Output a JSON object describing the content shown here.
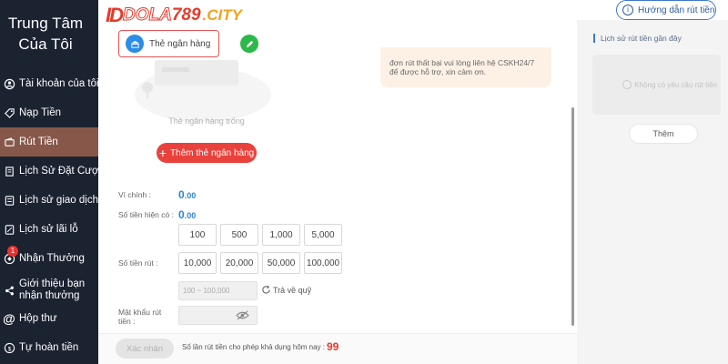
{
  "sidebar": {
    "title_line1": "Trung Tâm",
    "title_line2": "Của Tôi",
    "items": [
      {
        "label": "Tài khoản của tôi",
        "icon": "user-icon"
      },
      {
        "label": "Nạp Tiền",
        "icon": "tag-icon"
      },
      {
        "label": "Rút Tiền",
        "icon": "wallet-icon",
        "active": true
      },
      {
        "label": "Lịch Sử Đặt Cược",
        "icon": "document-icon"
      },
      {
        "label": "Lịch sử giao dịch",
        "icon": "list-icon"
      },
      {
        "label": "Lịch sử lãi lỗ",
        "icon": "chart-icon"
      },
      {
        "label": "Nhận Thưởng",
        "icon": "gift-icon",
        "badge": "1"
      },
      {
        "label": "Giới thiệu bạn nhận thưởng",
        "icon": "share-icon"
      },
      {
        "label": "Hộp thư",
        "icon": "at-icon"
      },
      {
        "label": "Tự hoàn tiền",
        "icon": "refund-icon"
      }
    ]
  },
  "logo": {
    "mark": "ID",
    "word_prefix": "DOLA",
    "word_digits": "789",
    "suffix": ".CITY"
  },
  "guide_button": {
    "label": "Hướng dẫn rút tiền",
    "icon": "question-icon"
  },
  "bank_tab": {
    "label": "Thẻ ngân hàng",
    "icon": "bank-icon"
  },
  "empty_bank": {
    "text": "Thẻ ngân hàng trống"
  },
  "add_bank_button": {
    "label": "Thêm thẻ ngân hàng"
  },
  "notice": {
    "text": "đơn rút thất bại vui lòng liên hệ CSKH24/7 để được hỗ trợ, xin cảm ơn."
  },
  "form": {
    "main_wallet_label": "Ví chính :",
    "main_wallet_value": "0",
    "main_wallet_decimals": ".00",
    "current_label": "Số tiền hiện có :",
    "current_value": "0",
    "current_decimals": ".00",
    "withdraw_label": "Số tiền rút :",
    "amounts_row1": [
      "100",
      "500",
      "1,000",
      "5,000"
    ],
    "amounts_row2": [
      "10,000",
      "20,000",
      "50,000",
      "100,000"
    ],
    "range_placeholder": "100 ~ 100,000",
    "return_label": "Trả về quỹ",
    "password_label": "Mật khẩu rút tiền :"
  },
  "bottom": {
    "confirm_label": "Xác nhận",
    "today_text": "Số lần rút tiền cho phép khả dụng hôm nay :",
    "today_count": "99"
  },
  "history": {
    "title": "Lịch sử rút tiền gần đây",
    "empty_text": "Không có yêu cầu rút tiền",
    "more_label": "Thêm"
  },
  "colors": {
    "sidebar_bg": "#1b2230",
    "sidebar_active": "#87584a",
    "accent_red": "#e9413b",
    "accent_blue": "#2a87d0",
    "edit_green": "#2db84a"
  }
}
